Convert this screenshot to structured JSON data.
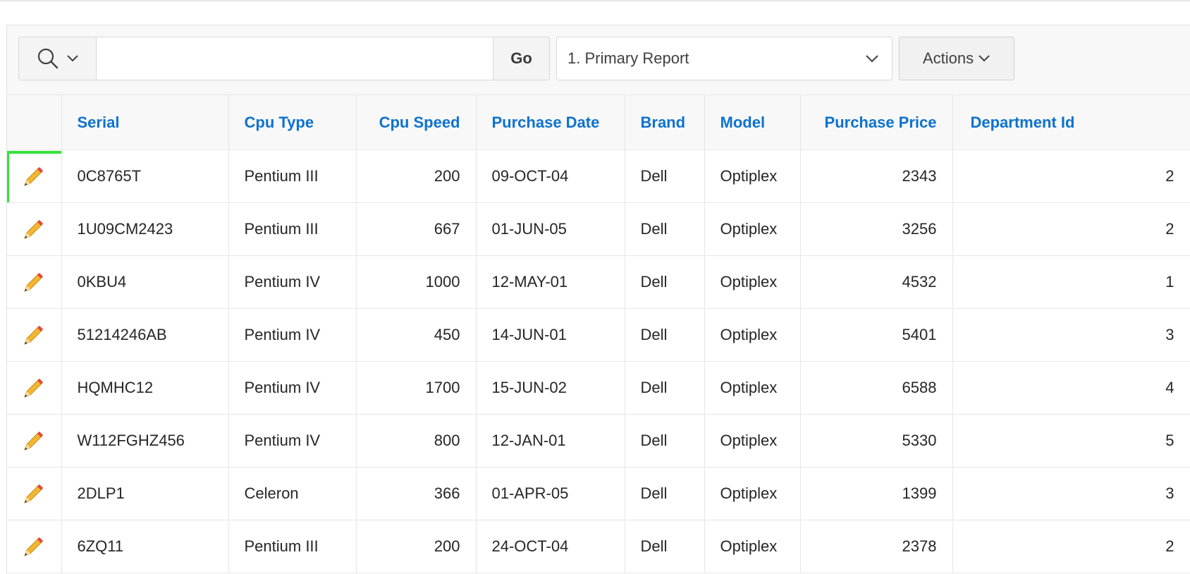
{
  "toolbar": {
    "search_value": "",
    "go_label": "Go",
    "report_selected": "1. Primary Report",
    "actions_label": "Actions"
  },
  "table": {
    "columns": [
      "Serial",
      "Cpu Type",
      "Cpu Speed",
      "Purchase Date",
      "Brand",
      "Model",
      "Purchase Price",
      "Department Id"
    ],
    "rows": [
      [
        "0C8765T",
        "Pentium III",
        "200",
        "09-OCT-04",
        "Dell",
        "Optiplex",
        "2343",
        "2"
      ],
      [
        "1U09CM2423",
        "Pentium III",
        "667",
        "01-JUN-05",
        "Dell",
        "Optiplex",
        "3256",
        "2"
      ],
      [
        "0KBU4",
        "Pentium IV",
        "1000",
        "12-MAY-01",
        "Dell",
        "Optiplex",
        "4532",
        "1"
      ],
      [
        "51214246AB",
        "Pentium IV",
        "450",
        "14-JUN-01",
        "Dell",
        "Optiplex",
        "5401",
        "3"
      ],
      [
        "HQMHC12",
        "Pentium IV",
        "1700",
        "15-JUN-02",
        "Dell",
        "Optiplex",
        "6588",
        "4"
      ],
      [
        "W112FGHZ456",
        "Pentium IV",
        "800",
        "12-JAN-01",
        "Dell",
        "Optiplex",
        "5330",
        "5"
      ],
      [
        "2DLP1",
        "Celeron",
        "366",
        "01-APR-05",
        "Dell",
        "Optiplex",
        "1399",
        "3"
      ],
      [
        "6ZQ11",
        "Pentium III",
        "200",
        "24-OCT-04",
        "Dell",
        "Optiplex",
        "2378",
        "2"
      ]
    ],
    "edit_icon": "pencil-icon",
    "highlighted_row": 0
  },
  "colors": {
    "header_link": "#0d72cf",
    "highlight": "#36e23a",
    "pencil_body": "#f2b632",
    "pencil_tip": "#e8453c"
  }
}
